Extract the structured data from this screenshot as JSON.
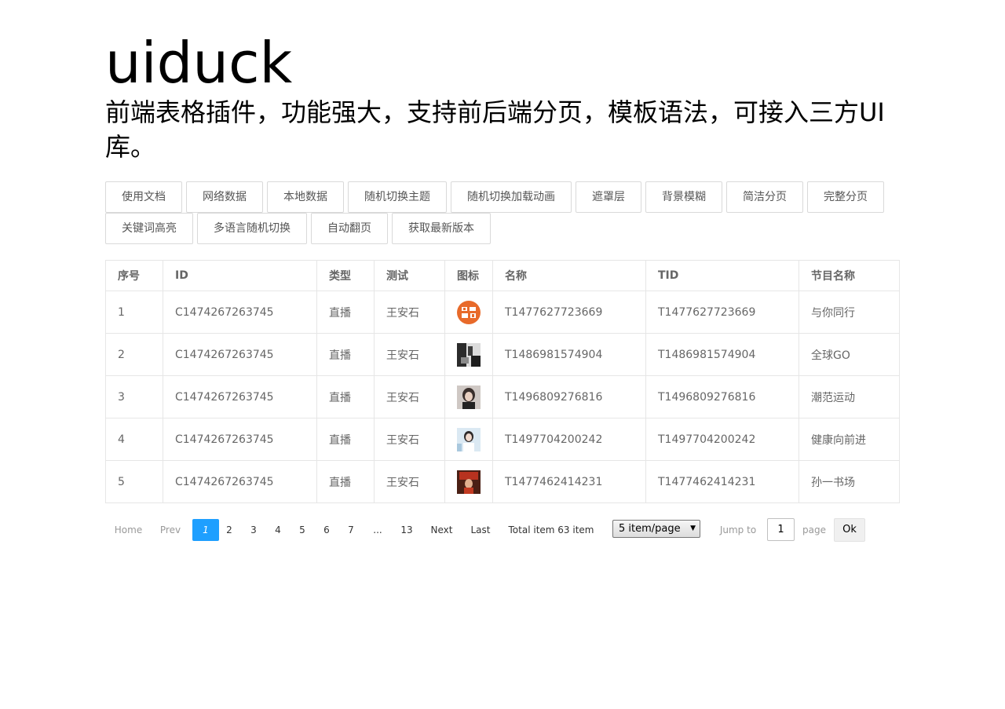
{
  "brand": "uiduck",
  "subtitle": "前端表格插件，功能强大，支持前后端分页，模板语法，可接入三方UI库。",
  "toolbar": {
    "row1": [
      "使用文档",
      "网络数据",
      "本地数据",
      "随机切换主题",
      "随机切换加载动画",
      "遮罩层",
      "背景模糊",
      "简洁分页",
      "完整分页"
    ],
    "row2": [
      "关键词高亮",
      "多语言随机切换",
      "自动翻页",
      "获取最新版本"
    ]
  },
  "table": {
    "headers": [
      "序号",
      "ID",
      "类型",
      "测试",
      "图标",
      "名称",
      "TID",
      "节目名称"
    ],
    "rows": [
      {
        "no": "1",
        "id": "C1474267263745",
        "type": "直播",
        "test": "王安石",
        "icon": "program-logo-orange",
        "name": "T1477627723669",
        "tid": "T1477627723669",
        "program": "与你同行"
      },
      {
        "no": "2",
        "id": "C1474267263745",
        "type": "直播",
        "test": "王安石",
        "icon": "program-photo-bw",
        "name": "T1486981574904",
        "tid": "T1486981574904",
        "program": "全球GO"
      },
      {
        "no": "3",
        "id": "C1474267263745",
        "type": "直播",
        "test": "王安石",
        "icon": "program-photo-person",
        "name": "T1496809276816",
        "tid": "T1496809276816",
        "program": "潮范运动"
      },
      {
        "no": "4",
        "id": "C1474267263745",
        "type": "直播",
        "test": "王安石",
        "icon": "program-photo-light",
        "name": "T1497704200242",
        "tid": "T1497704200242",
        "program": "健康向前进"
      },
      {
        "no": "5",
        "id": "C1474267263745",
        "type": "直播",
        "test": "王安石",
        "icon": "program-photo-red",
        "name": "T1477462414231",
        "tid": "T1477462414231",
        "program": "孙一书场"
      }
    ]
  },
  "pagination": {
    "home": "Home",
    "prev": "Prev",
    "pages": [
      "1",
      "2",
      "3",
      "4",
      "5",
      "6",
      "7"
    ],
    "current": "1",
    "ellipsis": "...",
    "last_page": "13",
    "next": "Next",
    "last": "Last",
    "total": "Total item 63 item",
    "per_page": "5 item/page",
    "jump_to": "Jump to",
    "jump_value": "1",
    "page_word": "page",
    "ok": "Ok"
  },
  "colors": {
    "accent": "#1E9FFF",
    "border": "#e6e6e6",
    "text": "#666666"
  }
}
